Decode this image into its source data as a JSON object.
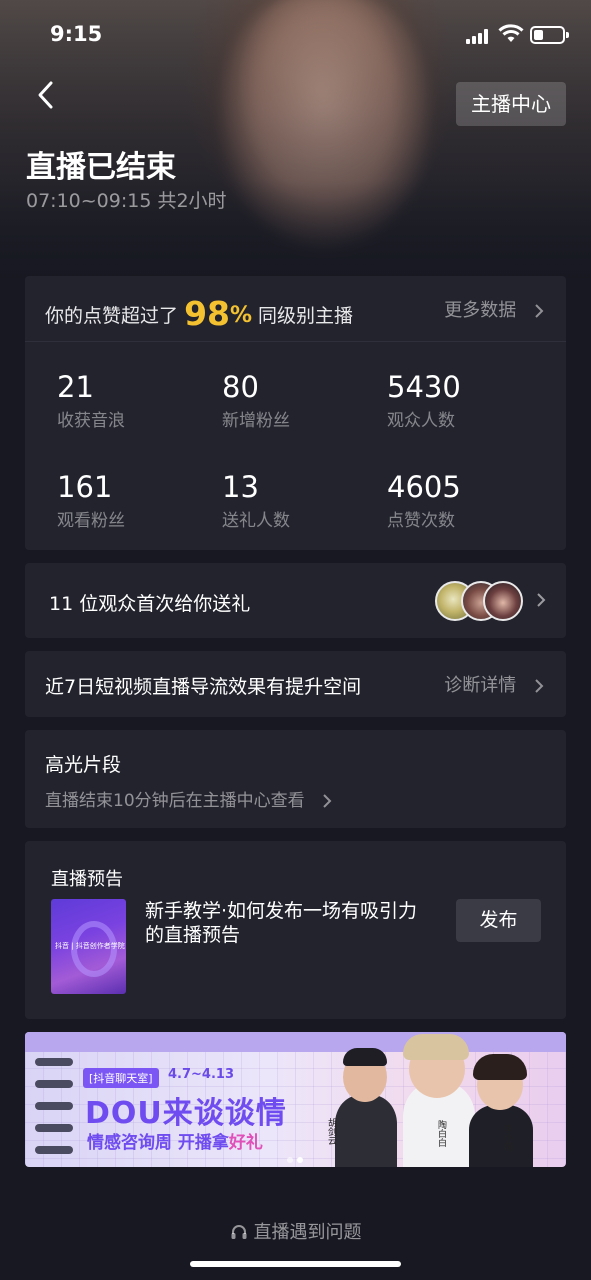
{
  "status_bar": {
    "time": "9:15"
  },
  "header": {
    "center_button": "主播中心",
    "title": "直播已结束",
    "subtitle": "07:10~09:15 共2小时"
  },
  "stats": {
    "like_prefix": "你的点赞超过了",
    "like_percent": "98",
    "like_percent_sign": "%",
    "like_suffix": "同级别主播",
    "more_data": "更多数据",
    "items": [
      {
        "value": "21",
        "label": "收获音浪"
      },
      {
        "value": "80",
        "label": "新增粉丝"
      },
      {
        "value": "5430",
        "label": "观众人数"
      },
      {
        "value": "161",
        "label": "观看粉丝"
      },
      {
        "value": "13",
        "label": "送礼人数"
      },
      {
        "value": "4605",
        "label": "点赞次数"
      }
    ]
  },
  "gift_row": {
    "text": "11 位观众首次给你送礼"
  },
  "traffic_row": {
    "text": "近7日短视频直播导流效果有提升空间",
    "link": "诊断详情"
  },
  "highlights": {
    "title": "高光片段",
    "subtitle": "直播结束10分钟后在主播中心查看"
  },
  "preview": {
    "title": "直播预告",
    "thumb_text": "抖音 | 抖音创作者学院",
    "description": "新手教学·如何发布一场有吸引力的直播预告",
    "button": "发布"
  },
  "banner": {
    "tag": "[抖音聊天室]",
    "date": "4.7~4.13",
    "title": "DOU来谈谈情",
    "subtitle_main": "情感咨询周 开播拿",
    "subtitle_highlight": "好礼",
    "names": [
      "胡剑云",
      "陶白白",
      "李小萌"
    ]
  },
  "footer": {
    "help": "直播遇到问题"
  },
  "colors": {
    "accent_gold": "#f4c231",
    "background": "#171821",
    "card": "#22232d",
    "banner_purple": "#6f4cf0"
  }
}
